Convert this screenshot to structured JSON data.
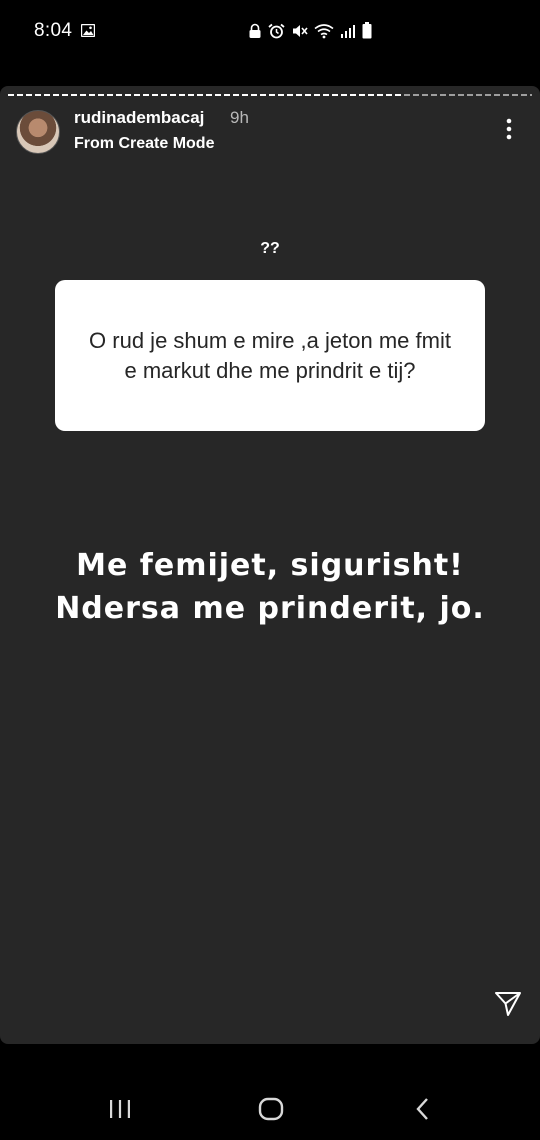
{
  "status_bar": {
    "time": "8:04",
    "icons": [
      "gallery-icon",
      "lock-icon",
      "alarm-icon",
      "mute-icon",
      "wifi-icon",
      "signal-icon",
      "battery-icon"
    ]
  },
  "story": {
    "progress": 0.75,
    "username": "rudinadembacaj",
    "time_ago": "9h",
    "subtitle": "From Create Mode",
    "question_label": "??",
    "question_text": "O rud je shum e mire ,a jeton me fmit e markut dhe me prindrit e tij?",
    "answer_line1": "Me femijet, sigurisht!",
    "answer_line2": "Ndersa me prinderit, jo."
  },
  "nav": {
    "icons": [
      "recents-icon",
      "home-icon",
      "back-icon"
    ]
  },
  "colors": {
    "background": "#000000",
    "story_bg": "#272727",
    "question_bg": "#ffffff",
    "text_light": "#ffffff",
    "text_dark": "#262626"
  }
}
